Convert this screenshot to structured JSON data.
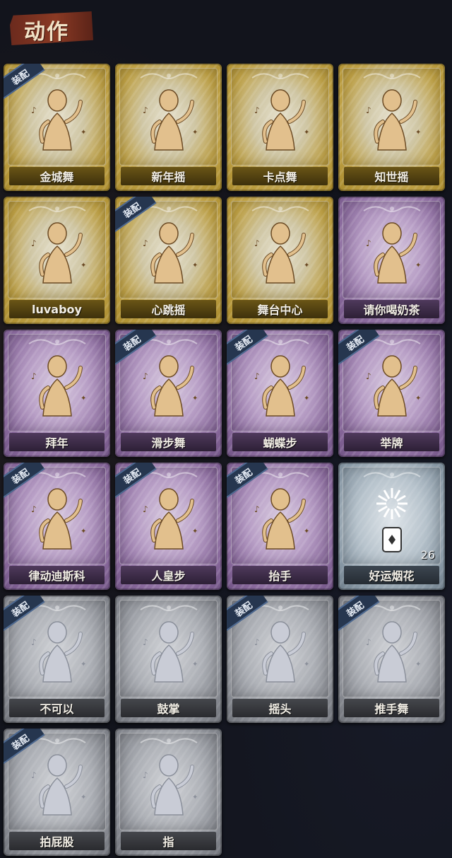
{
  "page_title": "动作",
  "equip_tag": "装配",
  "cards": [
    {
      "label": "金城舞",
      "rarity": "gold",
      "equipped": true,
      "icon": "figure-wave-icon"
    },
    {
      "label": "新年摇",
      "rarity": "gold",
      "equipped": false,
      "icon": "figure-clap-icon"
    },
    {
      "label": "卡点舞",
      "rarity": "gold",
      "equipped": false,
      "icon": "figure-point-up-icon"
    },
    {
      "label": "知世摇",
      "rarity": "gold",
      "equipped": false,
      "icon": "figure-hands-icon"
    },
    {
      "label": "luvaboy",
      "rarity": "gold",
      "equipped": false,
      "icon": "figure-cross-arm-icon"
    },
    {
      "label": "心跳摇",
      "rarity": "gold",
      "equipped": true,
      "icon": "figure-raise-hand-icon"
    },
    {
      "label": "舞台中心",
      "rarity": "gold",
      "equipped": false,
      "icon": "figure-star-pose-icon"
    },
    {
      "label": "请你喝奶茶",
      "rarity": "purple",
      "equipped": false,
      "icon": "figure-sign-icon"
    },
    {
      "label": "拜年",
      "rarity": "purple",
      "equipped": false,
      "icon": "figure-bow-icon"
    },
    {
      "label": "滑步舞",
      "rarity": "purple",
      "equipped": true,
      "icon": "figure-slide-icon"
    },
    {
      "label": "蝴蝶步",
      "rarity": "purple",
      "equipped": true,
      "icon": "figure-point-side-icon"
    },
    {
      "label": "举牌",
      "rarity": "purple",
      "equipped": true,
      "icon": "figure-hold-sign-icon"
    },
    {
      "label": "律动迪斯科",
      "rarity": "purple",
      "equipped": true,
      "icon": "figure-disco-icon"
    },
    {
      "label": "人皇步",
      "rarity": "purple",
      "equipped": true,
      "icon": "figure-spread-icon"
    },
    {
      "label": "抬手",
      "rarity": "purple",
      "equipped": true,
      "icon": "figure-lift-hand-icon"
    },
    {
      "label": "好运烟花",
      "rarity": "blue",
      "equipped": false,
      "icon": "firework-icon",
      "count": "26"
    },
    {
      "label": "不可以",
      "rarity": "grey",
      "equipped": true,
      "icon": "finger-no-icon"
    },
    {
      "label": "鼓掌",
      "rarity": "grey",
      "equipped": false,
      "icon": "clap-hands-icon"
    },
    {
      "label": "摇头",
      "rarity": "grey",
      "equipped": true,
      "icon": "figure-shake-head-icon"
    },
    {
      "label": "推手舞",
      "rarity": "grey",
      "equipped": true,
      "icon": "figure-push-hands-icon"
    },
    {
      "label": "拍屁股",
      "rarity": "grey",
      "equipped": true,
      "icon": "figure-pat-icon"
    },
    {
      "label": "指",
      "rarity": "grey",
      "equipped": false,
      "icon": "pointing-hand-icon"
    }
  ]
}
